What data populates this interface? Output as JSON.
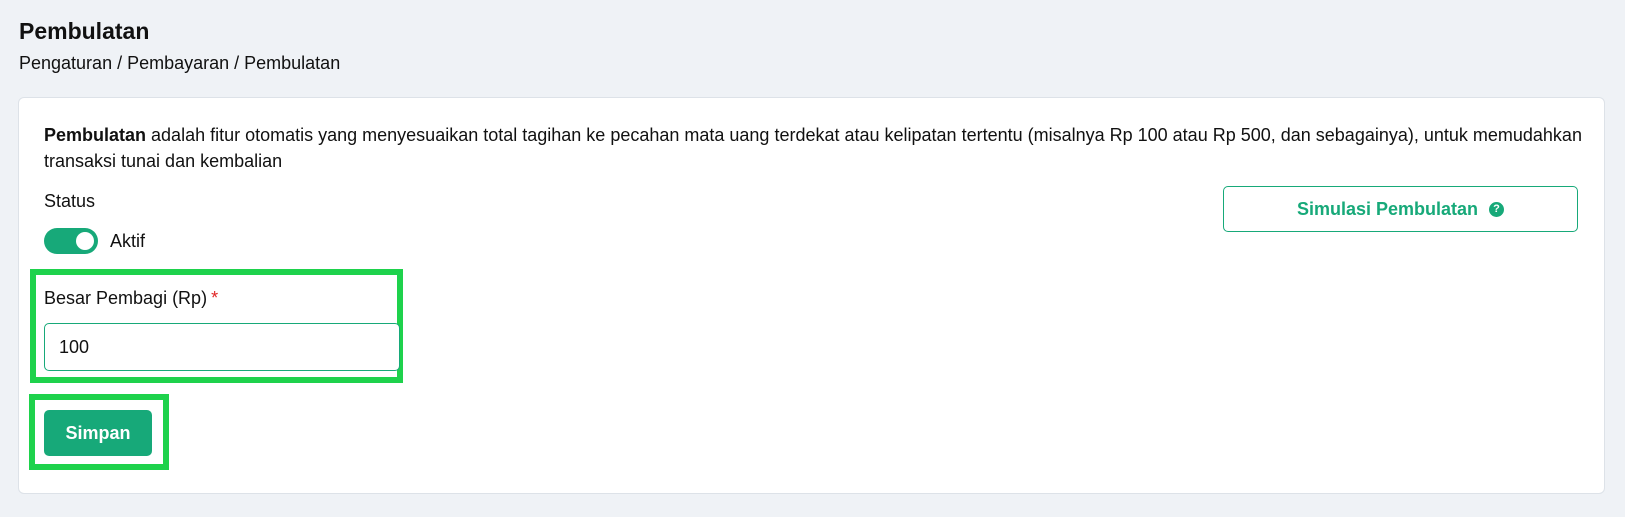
{
  "page": {
    "title": "Pembulatan",
    "breadcrumb": "Pengaturan / Pembayaran / Pembulatan"
  },
  "description": {
    "bold_term": "Pembulatan",
    "text": " adalah fitur otomatis yang menyesuaikan total tagihan ke pecahan mata uang terdekat atau kelipatan tertentu (misalnya Rp 100 atau Rp 500, dan sebagainya), untuk memudahkan transaksi tunai dan kembalian"
  },
  "status": {
    "label": "Status",
    "toggle_label": "Aktif",
    "enabled": true
  },
  "simulate_button": {
    "label": "Simulasi Pembulatan",
    "icon": "question-circle-icon"
  },
  "divisor_field": {
    "label": "Besar Pembagi (Rp)",
    "required_mark": "*",
    "value": "100"
  },
  "save_button": {
    "label": "Simpan"
  },
  "colors": {
    "accent": "#17a979",
    "highlight": "#1ed24c",
    "required": "#e02424",
    "background": "#eff2f6"
  }
}
